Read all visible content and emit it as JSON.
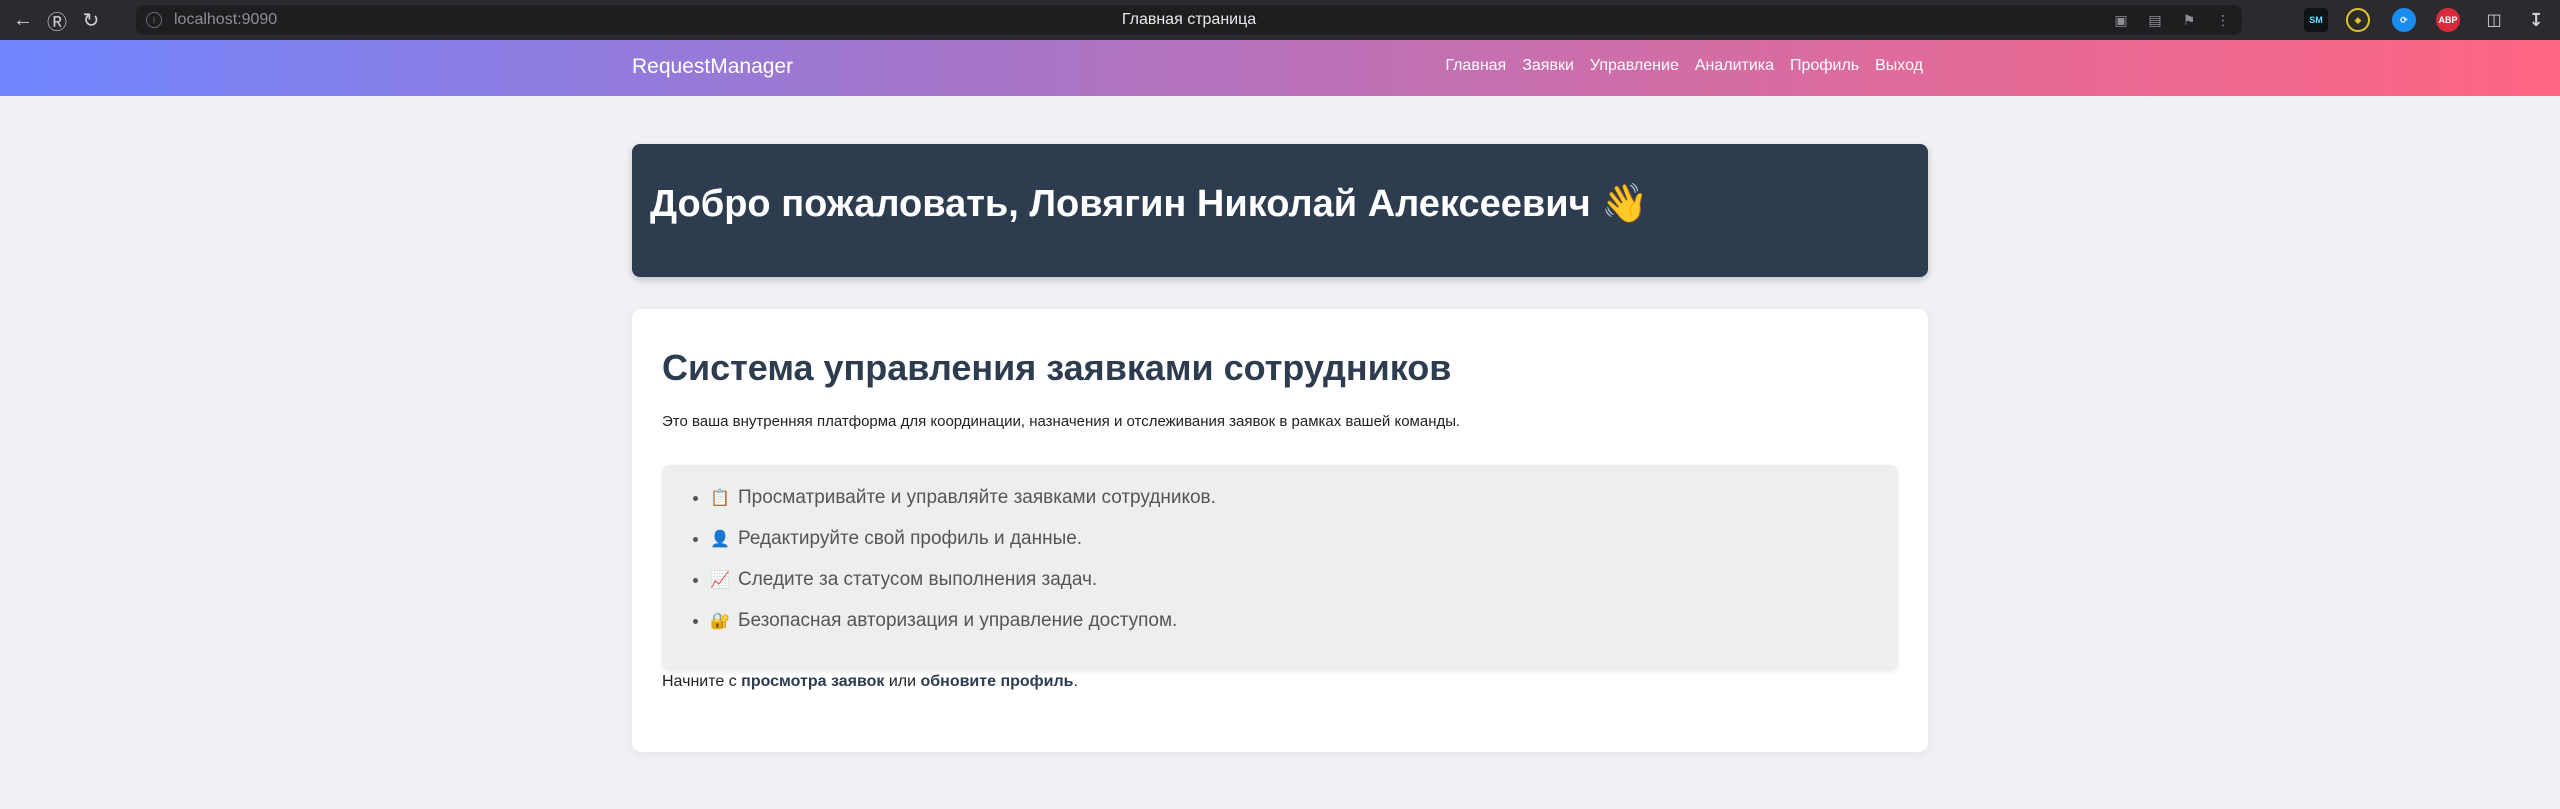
{
  "browser": {
    "url": "localhost:9090",
    "page_title": "Главная страница"
  },
  "app": {
    "brand": "RequestManager",
    "nav": [
      "Главная",
      "Заявки",
      "Управление",
      "Аналитика",
      "Профиль",
      "Выход"
    ]
  },
  "welcome": {
    "heading": "Добро пожаловать, Ловягин Николай Алексеевич 👋"
  },
  "info": {
    "title": "Система управления заявками сотрудников",
    "intro": "Это ваша внутренняя платформа для координации, назначения и отслеживания заявок в рамках вашей команды.",
    "features": [
      {
        "icon": "📋",
        "text": "Просматривайте и управляйте заявками сотрудников."
      },
      {
        "icon": "👤",
        "text": "Редактируйте свой профиль и данные."
      },
      {
        "icon": "📈",
        "text": "Следите за статусом выполнения задач."
      },
      {
        "icon": "🔐",
        "text": "Безопасная авторизация и управление доступом."
      }
    ],
    "outro": {
      "prefix": "Начните с ",
      "link1": "просмотра заявок",
      "middle": " или ",
      "link2": "обновите профиль",
      "suffix": "."
    }
  },
  "colors": {
    "header_gradient": [
      "#6f86ff",
      "#a974c6",
      "#e06b9a",
      "#ff6683"
    ],
    "banner_bg": "#2e3c50",
    "page_bg": "#f0f1f4"
  }
}
